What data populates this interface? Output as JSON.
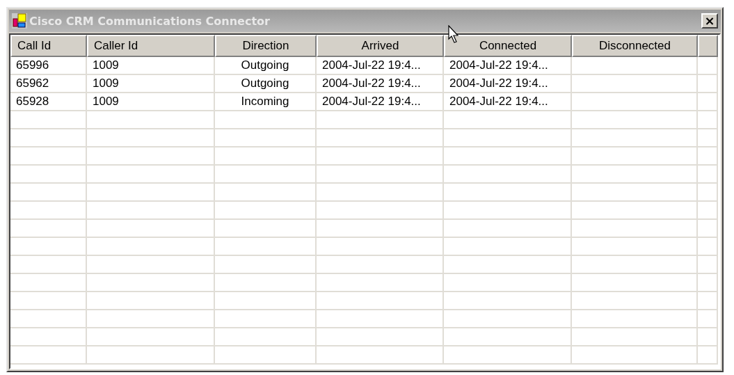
{
  "window": {
    "title": "Cisco CRM Communications Connector",
    "close_label": "×"
  },
  "table": {
    "columns": [
      "Call Id",
      "Caller Id",
      "Direction",
      "Arrived",
      "Connected",
      "Disconnected"
    ],
    "rows": [
      [
        "65996",
        "1009",
        "Outgoing",
        "2004-Jul-22 19:4...",
        "2004-Jul-22 19:4...",
        ""
      ],
      [
        "65962",
        "1009",
        "Outgoing",
        "2004-Jul-22 19:4...",
        "2004-Jul-22 19:4...",
        ""
      ],
      [
        "65928",
        "1009",
        "Incoming",
        "2004-Jul-22 19:4...",
        "2004-Jul-22 19:4...",
        ""
      ]
    ]
  }
}
